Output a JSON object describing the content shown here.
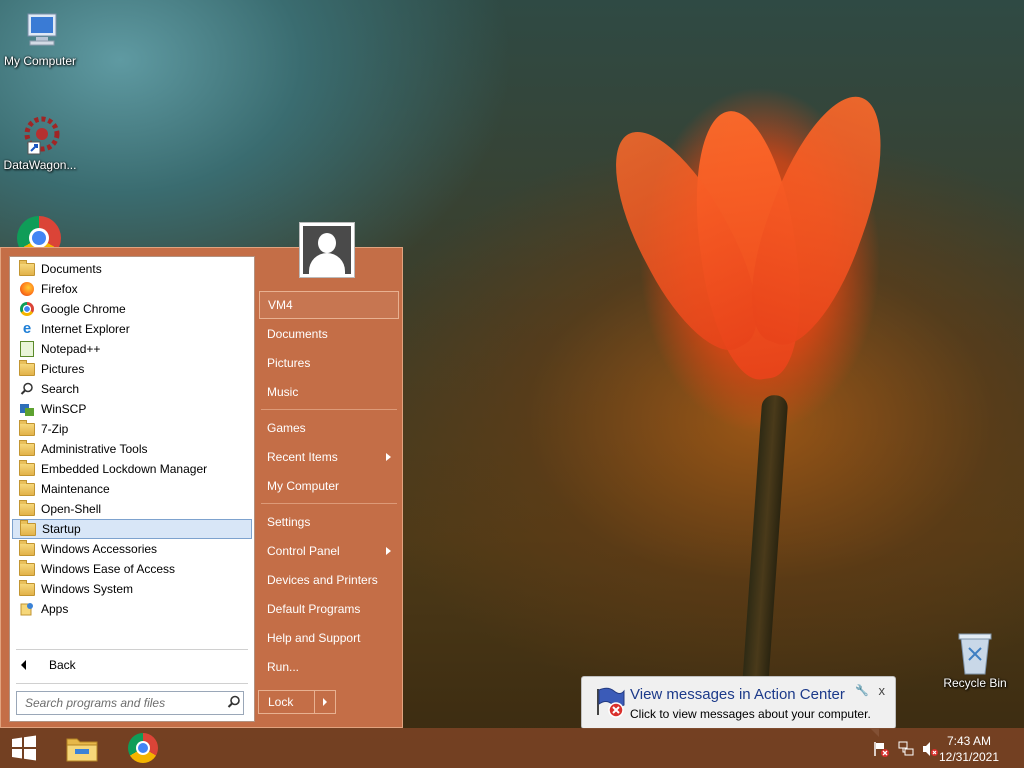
{
  "desktop": {
    "icons": [
      {
        "label": "My Computer"
      },
      {
        "label": "DataWagon..."
      },
      {
        "label": "Recycle Bin"
      }
    ]
  },
  "start_menu": {
    "programs": [
      {
        "label": "Documents",
        "icon": "folder-icon"
      },
      {
        "label": "Firefox",
        "icon": "firefox-icon"
      },
      {
        "label": "Google Chrome",
        "icon": "chrome-icon"
      },
      {
        "label": "Internet Explorer",
        "icon": "ie-icon"
      },
      {
        "label": "Notepad++",
        "icon": "notepad-icon"
      },
      {
        "label": "Pictures",
        "icon": "folder-icon"
      },
      {
        "label": "Search",
        "icon": "search-icon"
      },
      {
        "label": "WinSCP",
        "icon": "winscp-icon"
      },
      {
        "label": "7-Zip",
        "icon": "folder-icon"
      },
      {
        "label": "Administrative Tools",
        "icon": "folder-icon"
      },
      {
        "label": "Embedded Lockdown Manager",
        "icon": "folder-icon"
      },
      {
        "label": "Maintenance",
        "icon": "folder-icon"
      },
      {
        "label": "Open-Shell",
        "icon": "folder-icon"
      },
      {
        "label": "Startup",
        "icon": "folder-icon",
        "selected": true
      },
      {
        "label": "Windows Accessories",
        "icon": "folder-icon"
      },
      {
        "label": "Windows Ease of Access",
        "icon": "folder-icon"
      },
      {
        "label": "Windows System",
        "icon": "folder-icon"
      },
      {
        "label": "Apps",
        "icon": "apps-icon"
      }
    ],
    "back_label": "Back",
    "search_placeholder": "Search programs and files",
    "right_items": {
      "user": "VM4",
      "documents": "Documents",
      "pictures": "Pictures",
      "music": "Music",
      "games": "Games",
      "recent_items": "Recent Items",
      "my_computer": "My Computer",
      "settings": "Settings",
      "control_panel": "Control Panel",
      "devices_printers": "Devices and Printers",
      "default_programs": "Default Programs",
      "help_support": "Help and Support",
      "run": "Run..."
    },
    "lock_label": "Lock"
  },
  "notification": {
    "title": "View messages in Action Center",
    "body": "Click to view messages about your computer.",
    "close": "x"
  },
  "taskbar": {
    "time": "7:43 AM",
    "date": "12/31/2021"
  }
}
